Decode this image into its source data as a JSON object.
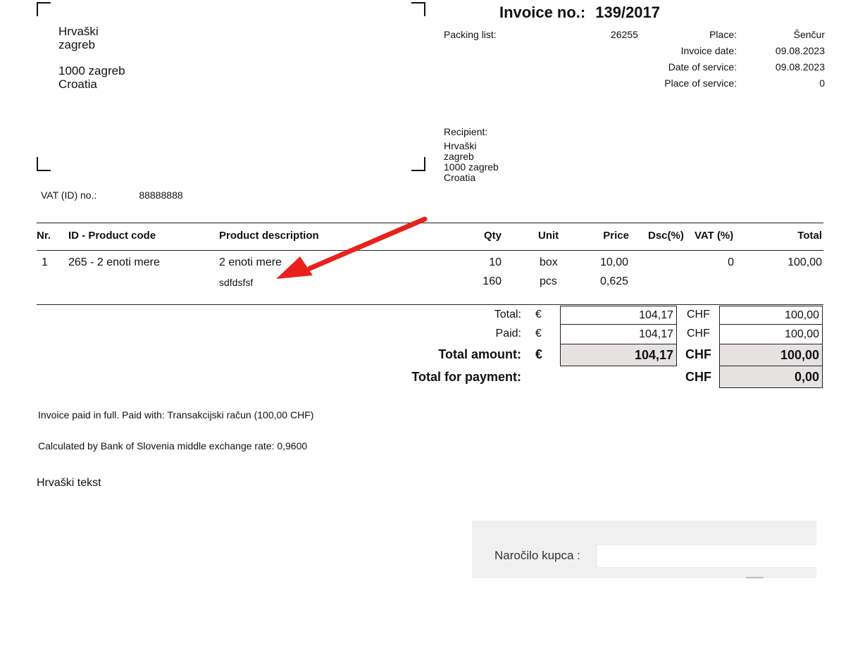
{
  "sender": {
    "line1": "Hrvaški",
    "line2": "zagreb",
    "line3": "1000 zagreb",
    "line4": "Croatia"
  },
  "invoice": {
    "title_label": "Invoice no.:",
    "number": "139/2017",
    "packing_list_label": "Packing list:",
    "packing_list_value": "26255",
    "place_label": "Place:",
    "place_value": "Šenčur",
    "invoice_date_label": "Invoice date:",
    "invoice_date_value": "09.08.2023",
    "date_of_service_label": "Date of service:",
    "date_of_service_value": "09.08.2023",
    "place_of_service_label": "Place of service:",
    "place_of_service_value": "0"
  },
  "recipient": {
    "label": "Recipient:",
    "line1": "Hrvaški",
    "line2": "zagreb",
    "line3": "1000 zagreb",
    "line4": "Croatia"
  },
  "vat": {
    "label": "VAT (ID) no.:",
    "value": "88888888"
  },
  "table": {
    "headers": {
      "nr": "Nr.",
      "code": "ID - Product code",
      "desc": "Product description",
      "qty": "Qty",
      "unit": "Unit",
      "price": "Price",
      "dsc": "Dsc(%)",
      "vat": "VAT (%)",
      "total": "Total"
    },
    "rows": [
      {
        "nr": "1",
        "code": "265 - 2 enoti mere",
        "desc": "2 enoti mere",
        "desc2": "sdfdsfsf",
        "qty": "10",
        "qty2": "160",
        "unit": "box",
        "unit2": "pcs",
        "price": "10,00",
        "price2": "0,625",
        "vat": "0",
        "total": "100,00"
      }
    ]
  },
  "totals": {
    "total_label": "Total:",
    "paid_label": "Paid:",
    "total_amount_label": "Total amount:",
    "total_for_payment_label": "Total for payment:",
    "eur_symbol": "€",
    "chf_label": "CHF",
    "total_eur": "104,17",
    "total_chf": "100,00",
    "paid_eur": "104,17",
    "paid_chf": "100,00",
    "amount_eur": "104,17",
    "amount_chf": "100,00",
    "payment_chf": "0,00"
  },
  "notes": {
    "paid_note": "Invoice paid in full. Paid with: Transakcijski račun (100,00 CHF)",
    "rate_note": "Calculated by Bank of Slovenia middle exchange rate: 0,9600",
    "footer_text": "Hrvaški tekst"
  },
  "order_panel": {
    "label": "Naročilo kupca :",
    "value": ""
  },
  "colors": {
    "arrow": "#e8211c",
    "panel_bg": "#f0f0f0",
    "grey_box": "#e6e2e2"
  }
}
